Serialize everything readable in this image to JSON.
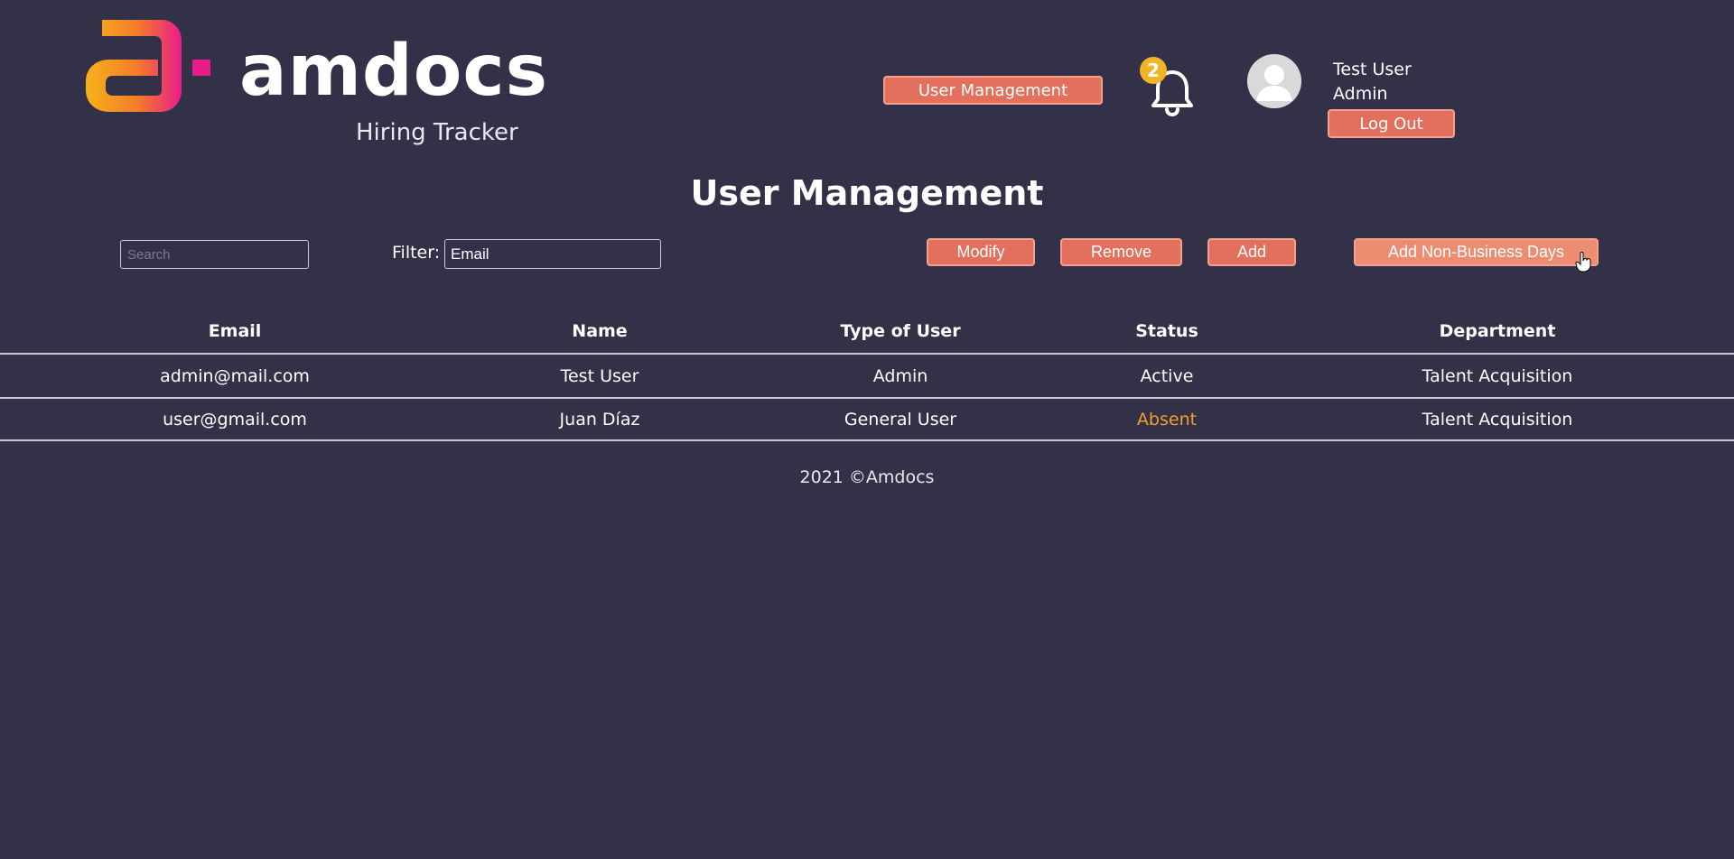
{
  "brand": {
    "name": "amdocs",
    "subtitle": "Hiring Tracker",
    "colors": {
      "gradient_start": "#f6b21b",
      "gradient_end": "#ea1c8c",
      "accent_button": "#e2705c",
      "background": "#333148",
      "absent_status": "#f0a030"
    }
  },
  "header": {
    "nav_button": "User Management",
    "notifications": {
      "icon": "bell-icon",
      "count": "2"
    },
    "user": {
      "avatar_icon": "user-avatar-icon",
      "name": "Test User",
      "role": "Admin",
      "logout_label": "Log Out"
    }
  },
  "page": {
    "title": "User Management"
  },
  "toolbar": {
    "search_placeholder": "Search",
    "filter_label": "Filter:",
    "filter_value": "Email",
    "modify_label": "Modify",
    "remove_label": "Remove",
    "add_label": "Add",
    "non_business_label": "Add Non-Business Days"
  },
  "table": {
    "columns": [
      "Email",
      "Name",
      "Type of User",
      "Status",
      "Department"
    ],
    "rows": [
      [
        "admin@mail.com",
        "Test User",
        "Admin",
        "Active",
        "Talent Acquisition"
      ],
      [
        "user@gmail.com",
        "Juan Díaz",
        "General User",
        "Absent",
        "Talent Acquisition"
      ]
    ]
  },
  "footer": {
    "text": "2021 ©Amdocs"
  }
}
